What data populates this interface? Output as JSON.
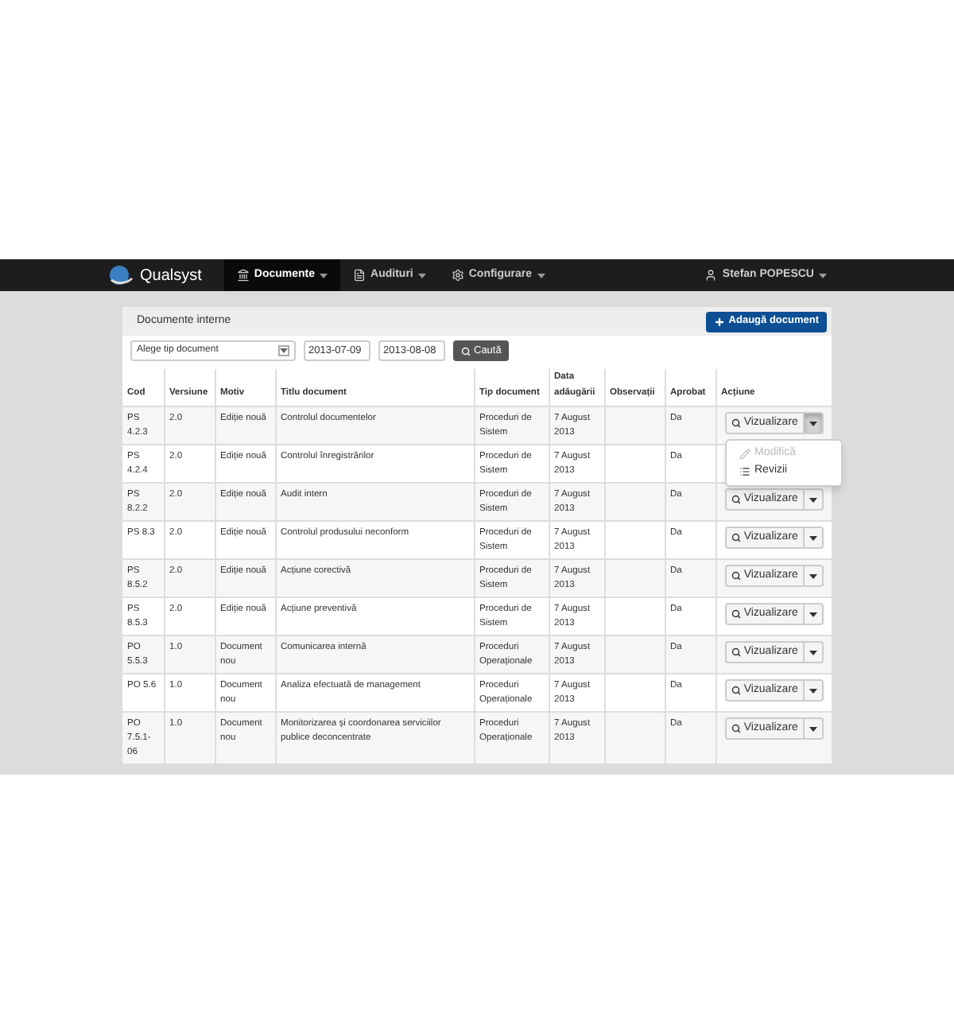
{
  "navbar": {
    "brand": "Qualsyst",
    "menus": [
      {
        "label": "Documente",
        "selected": true,
        "kind": "building"
      },
      {
        "label": "Audituri",
        "selected": false,
        "kind": "report"
      },
      {
        "label": "Configurare",
        "selected": false,
        "kind": "gear"
      }
    ],
    "user": "Stefan POPESCU"
  },
  "panel": {
    "title": "Documente interne",
    "add_button": "Adaugă document",
    "filter": {
      "select": "Alege tip document",
      "date_from": "2013-07-09",
      "date_to": "2013-08-08",
      "search_button": "Caută"
    },
    "table": {
      "columns": [
        "Cod",
        "Versiune",
        "Motiv",
        "Titlu document",
        "Tip document",
        "Data adăugării",
        "Observații",
        "Aprobat",
        "Acțiune"
      ],
      "rows": [
        {
          "cells": [
            "PS 4.2.3",
            "2.0",
            "Ediție nouă",
            "Controlul documentelor",
            "Proceduri de Sistem",
            "7 August 2013",
            "",
            "Da"
          ],
          "action": "Vizualizare",
          "menu_open": true
        },
        {
          "cells": [
            "PS 4.2.4",
            "2.0",
            "Ediție nouă",
            "Controlul înregistrărilor",
            "Proceduri de Sistem",
            "7 August 2013",
            "",
            "Da"
          ]
        },
        {
          "cells": [
            "PS 8.2.2",
            "2.0",
            "Ediție nouă",
            "Audit intern",
            "Proceduri de Sistem",
            "7 August 2013",
            "",
            "Da"
          ],
          "action": "Vizualizare",
          "menu_open": false
        },
        {
          "cells": [
            "PS 8.3",
            "2.0",
            "Ediție nouă",
            "Controlul produsului neconform",
            "Proceduri de Sistem",
            "7 August 2013",
            "",
            "Da"
          ],
          "action": "Vizualizare",
          "menu_open": false
        },
        {
          "cells": [
            "PS 8.5.2",
            "2.0",
            "Ediție nouă",
            "Acțiune corectivă",
            "Proceduri de Sistem",
            "7 August 2013",
            "",
            "Da"
          ],
          "action": "Vizualizare",
          "menu_open": false
        },
        {
          "cells": [
            "PS 8.5.3",
            "2.0",
            "Ediție nouă",
            "Acțiune preventivă",
            "Proceduri de Sistem",
            "7 August 2013",
            "",
            "Da"
          ],
          "action": "Vizualizare",
          "menu_open": false
        },
        {
          "cells": [
            "PO 5.5.3",
            "1.0",
            "Document nou",
            "Comunicarea internă",
            "Proceduri Operaționale",
            "7 August 2013",
            "",
            "Da"
          ],
          "action": "Vizualizare",
          "menu_open": false
        },
        {
          "cells": [
            "PO 5.6",
            "1.0",
            "Document nou",
            "Analiza efectuată de management",
            "Proceduri Operaționale",
            "7 August 2013",
            "",
            "Da"
          ],
          "action": "Vizualizare",
          "menu_open": false
        },
        {
          "cells": [
            "PO 7.5.1-06",
            "1.0",
            "Document nou",
            "Monitorizarea și coordonarea serviciilor publice deconcentrate",
            "Proceduri Operaționale",
            "7 August 2013",
            "",
            "Da"
          ],
          "action": "Vizualizare",
          "menu_open": false
        }
      ]
    },
    "dropdown": {
      "items": [
        {
          "label": "Modifică",
          "disabled": true,
          "kind": "edit"
        },
        {
          "label": "Revizii",
          "disabled": false,
          "kind": "list"
        }
      ]
    }
  }
}
